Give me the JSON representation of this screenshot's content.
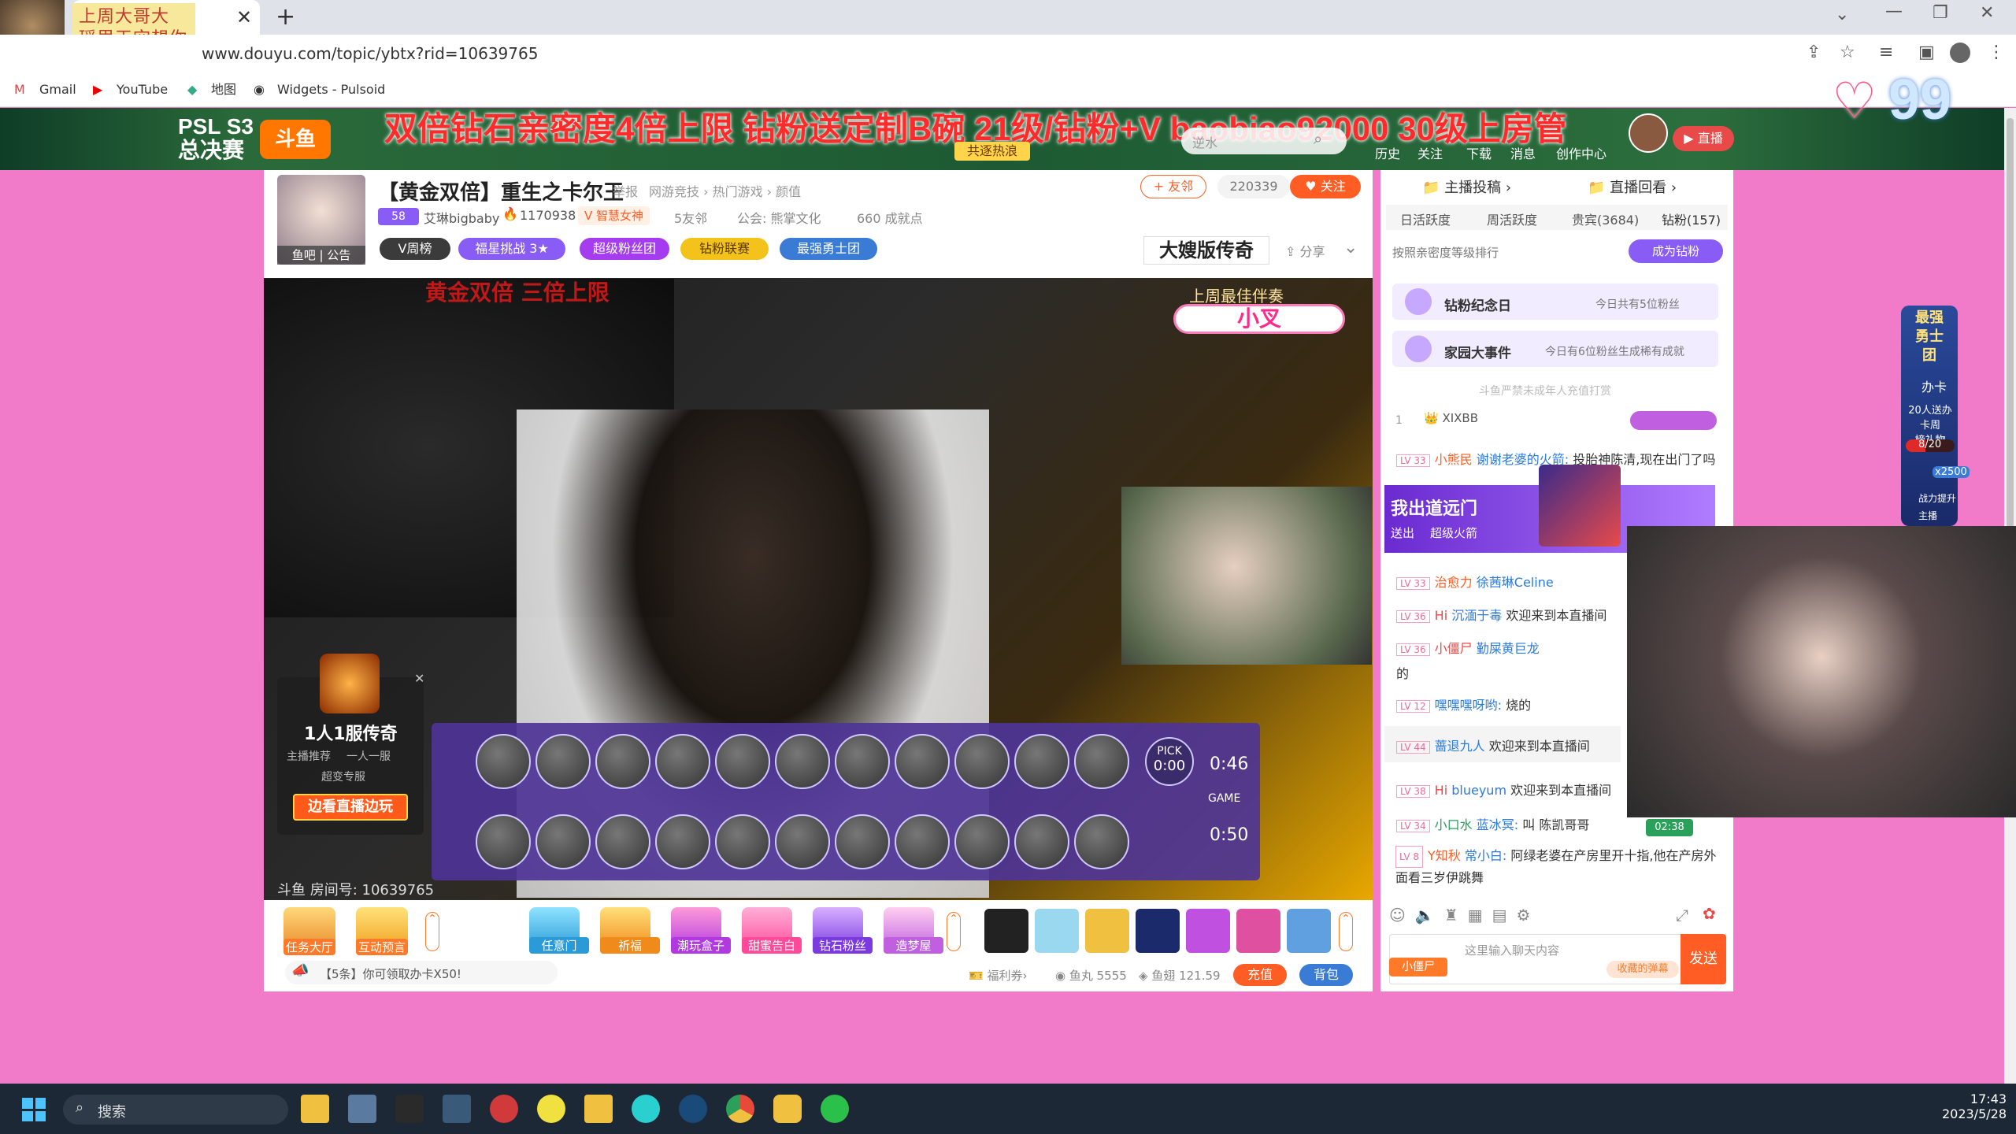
{
  "browser": {
    "tab_title_line1": "上周大哥大",
    "tab_title_line2": "瑶里天空想你",
    "url": "www.douyu.com/topic/ybtx?rid=10639765",
    "bookmarks": [
      "Gmail",
      "YouTube",
      "地图",
      "Widgets - Pulsoid"
    ]
  },
  "banner": {
    "event_line1": "PSL S3",
    "event_line2": "总决赛",
    "ticker": "双倍钻石亲密度4倍上限 钻粉送定制B碗 21级/钻粉+V baobiao92000 30级上房管",
    "tag": "共逐热浪",
    "search_placeholder": "逆水",
    "nav": [
      "历史",
      "关注",
      "下载",
      "消息",
      "创作中心"
    ],
    "heart_count": "99"
  },
  "room": {
    "title": "【黄金双倍】重生之卡尔王",
    "report": "举报",
    "categories": "网游竞技 › 热门游戏 › 颜值",
    "friend_btn": "+ 友邻",
    "follower_count": "220339",
    "follow_btn": "关注",
    "badge_level": "58",
    "streamer": "艾琳bigbaby",
    "heat": "1170938",
    "tag_vip": "智慧女神",
    "friends": "5友邻",
    "guild": "公会: 熊掌文化",
    "achievements": "660 成就点",
    "avatar_caption": "鱼吧 | 公告",
    "pills": [
      "V周榜",
      "福星挑战 3★",
      "超级粉丝团",
      "钻粉联赛",
      "最强勇士团"
    ],
    "game_ad": "大嫂版传奇",
    "share": "分享",
    "room_id": "斗鱼 房间号: 10639765"
  },
  "video": {
    "overlay_top": "上周最佳伴奏",
    "overlay_name": "小叉",
    "pick_label": "PICK",
    "pick_time": "0:00",
    "timer1": "0:46",
    "timer2": "0:50",
    "game_label": "GAME",
    "ad_title": "1人1服传奇",
    "ad_sub1": "主播推荐",
    "ad_sub2": "一人一服",
    "ad_sub3": "超变专服",
    "ad_btn": "边看直播边玩",
    "banner_top": "黄金双倍 三倍上限"
  },
  "gifts": {
    "left": [
      "任务大厅",
      "互动预言"
    ],
    "center": [
      "任意门",
      "祈福",
      "潮玩盒子",
      "甜蜜告白",
      "钻石粉丝",
      "造梦屋"
    ],
    "notice": "【5条】你可领取办卡X50!",
    "welfare": "福利券",
    "fish_ball": "鱼丸 5555",
    "fish_wing": "鱼翅 121.59",
    "recharge": "充值",
    "backpack": "背包"
  },
  "chat": {
    "top_tabs": [
      "主播投稿",
      "直播回看"
    ],
    "rank_tabs": [
      "日活跃度",
      "周活跃度",
      "贵宾(3684)",
      "钻粉(157)"
    ],
    "rank_desc": "按照亲密度等级排行",
    "diamond_btn": "成为钻粉",
    "event1": "钻粉纪念日",
    "event1_desc": "今日共有5位粉丝",
    "event2": "家园大事件",
    "event2_desc": "今日有6位粉丝生成稀有成就",
    "warning": "斗鱼严禁未成年人充值打赏",
    "top_rank": "1",
    "top_user": "XIXBB",
    "messages": [
      {
        "lv": "LV 33",
        "badge": "小熊民",
        "user": "谢谢老婆的火箭:",
        "text": "投胎神陈清,现在出门了吗"
      },
      {
        "lv": "LV 33",
        "badge": "治愈力",
        "user": "徐茜琳Celine",
        "text": ""
      },
      {
        "lv": "LV 36",
        "badge": "Hi",
        "user": "沉湎于毒",
        "text": "欢迎来到本直播间"
      },
      {
        "lv": "LV 36",
        "badge": "小僵尸",
        "user": "勤屎黄巨龙",
        "text": "的"
      },
      {
        "lv": "LV 12",
        "badge": "",
        "user": "嘿嘿嘿呀哟:",
        "text": "烧的"
      },
      {
        "lv": "LV 44",
        "badge": "",
        "user": "蔷退九人",
        "text": "欢迎来到本直播间"
      },
      {
        "lv": "LV 38",
        "badge": "Hi",
        "user": "blueyum",
        "text": "欢迎来到本直播间"
      },
      {
        "lv": "LV 34",
        "badge": "小口水",
        "user": "蓝冰冥:",
        "text": "叫 陈凯哥哥"
      },
      {
        "lv": "LV 8",
        "badge": "Y知秋",
        "user": "常小白:",
        "text": "阿绿老婆在产房里开十指,他在产房外面看三岁伊跳舞"
      }
    ],
    "gift_popup_title": "我出道远门",
    "gift_popup_sub1": "送出",
    "gift_popup_sub2": "超级火箭",
    "timer": "02:38",
    "input_placeholder": "这里输入聊天内容",
    "send_btn": "发送",
    "badge_select": "小僵尸",
    "barrage": "收藏的弹幕"
  },
  "side_widget": {
    "title": "最强勇士团",
    "card": "办卡",
    "desc1": "20人送办卡周",
    "desc2": "榜礼物",
    "progress": "8/20",
    "progress_fraction": 0.4,
    "bonus": "x2500",
    "sub": "战力提升",
    "sub2": "主播"
  },
  "taskbar": {
    "search": "搜索",
    "time": "17:43",
    "date": "2023/5/28"
  },
  "colors": {
    "page_bg": "#f17ac9",
    "accent": "#ff5d23",
    "douyu_orange": "#ff7700",
    "purple": "#8a5cf6"
  }
}
